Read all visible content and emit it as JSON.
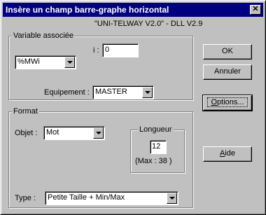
{
  "dialog": {
    "title": "Insère un champ barre-graphe horizontal",
    "close_label": "✕",
    "subtitle": "\"UNI-TELWAY V2.0\" - DLL V2.9"
  },
  "variable_group": {
    "legend": "Variable associée",
    "variable_value": "%MWi",
    "index_label": "i :",
    "index_value": "0",
    "equipement_label": "Equipement :",
    "equipement_value": "MASTER"
  },
  "format_group": {
    "legend": "Format",
    "objet_label": "Objet :",
    "objet_value": "Mot",
    "longueur_legend": "Longueur",
    "longueur_value": "12",
    "max_text": "(Max : 38   )",
    "type_label": "Type :",
    "type_value": "Petite Taille + Min/Max"
  },
  "buttons": {
    "ok": "OK",
    "annuler": "Annuler",
    "options_first": "O",
    "options_rest": "ptions...",
    "aide_first": "A",
    "aide_rest": "ide"
  }
}
